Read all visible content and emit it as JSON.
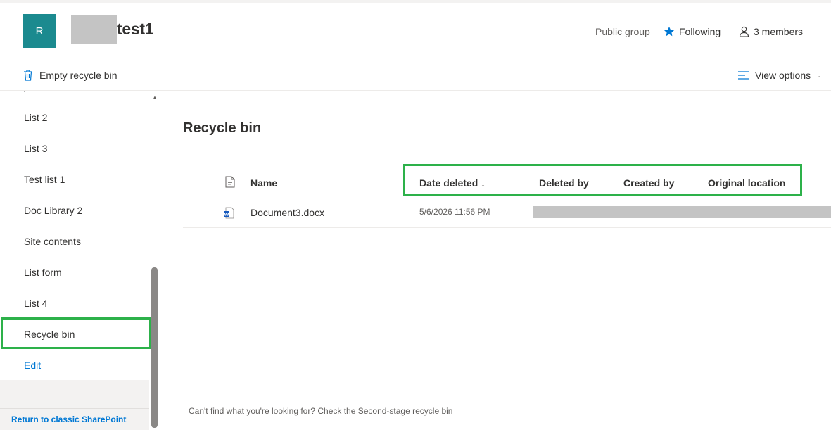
{
  "header": {
    "logo_letter": "R",
    "site_title": "test1",
    "public_group": "Public group",
    "following": "Following",
    "members": "3 members"
  },
  "command_bar": {
    "empty_recycle_bin": "Empty recycle bin",
    "view_options": "View options"
  },
  "nav": {
    "items": [
      {
        "label": "List 2"
      },
      {
        "label": "List 3"
      },
      {
        "label": "Test list 1"
      },
      {
        "label": "Doc Library 2"
      },
      {
        "label": "Site contents"
      },
      {
        "label": "List form"
      },
      {
        "label": "List 4"
      },
      {
        "label": "Recycle bin"
      }
    ],
    "edit": "Edit",
    "return_classic": "Return to classic SharePoint"
  },
  "main": {
    "heading": "Recycle bin",
    "columns": {
      "name": "Name",
      "date_deleted": "Date deleted",
      "sort_indicator": "↓",
      "deleted_by": "Deleted by",
      "created_by": "Created by",
      "original_location": "Original location"
    },
    "rows": [
      {
        "name": "Document3.docx",
        "date_deleted": "5/6/2026 11:56 PM"
      }
    ],
    "footer_text": "Can't find what you're looking for? Check the ",
    "footer_link": "Second-stage recycle bin"
  },
  "colors": {
    "logo_bg": "#1b8a8f",
    "accent": "#0078d4",
    "highlight": "#2db14a",
    "redaction": "#c4c4c4"
  },
  "icons": [
    "star-icon",
    "person-icon",
    "trash-icon",
    "view-lines-icon",
    "chevron-down-icon",
    "file-icon",
    "word-doc-icon",
    "scroll-up-arrow-icon"
  ]
}
